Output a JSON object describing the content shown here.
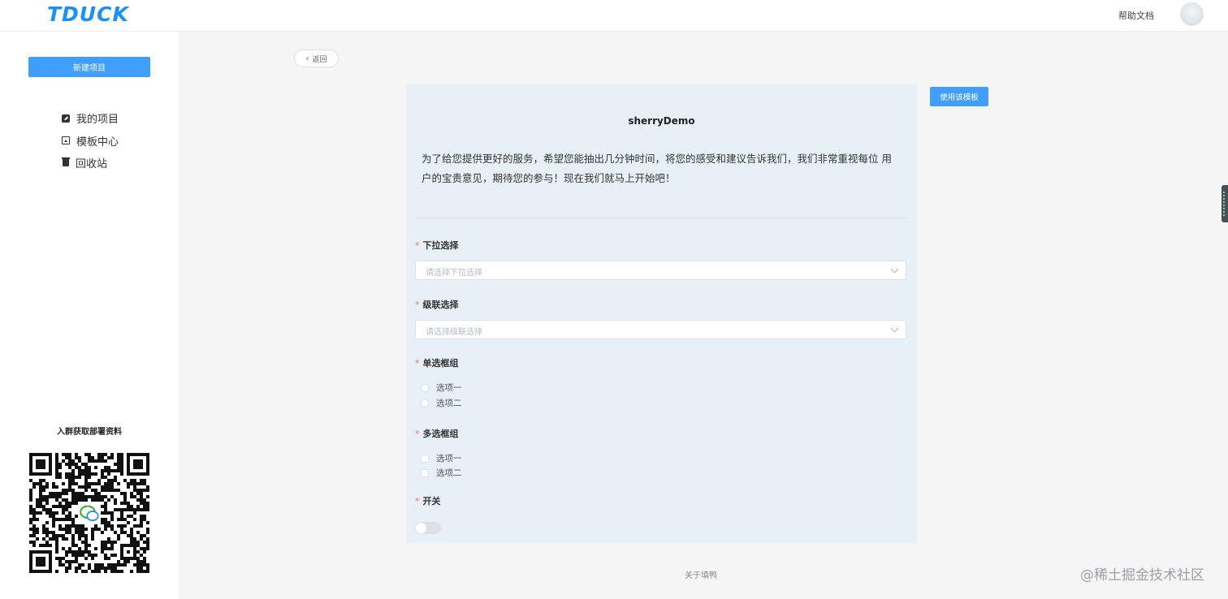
{
  "header": {
    "logo_text": "TDUCK",
    "help_link": "帮助文档",
    "avatar": "user-avatar"
  },
  "sidebar": {
    "new_project_label": "新建项目",
    "items": [
      {
        "label": "我的项目",
        "icon": "edit-icon"
      },
      {
        "label": "模板中心",
        "icon": "template-icon"
      },
      {
        "label": "回收站",
        "icon": "trash-icon"
      }
    ],
    "qr_title": "入群获取部署资料"
  },
  "toolbar": {
    "back_label": "返回",
    "use_template_label": "使用该模板"
  },
  "form": {
    "title": "sherryDemo",
    "description": "为了给您提供更好的服务，希望您能抽出几分钟时间，将您的感受和建议告诉我们，我们非常重视每位 用户的宝贵意见，期待您的参与！现在我们就马上开始吧！",
    "questions": [
      {
        "label": "下拉选择",
        "required_mark": "*",
        "placeholder": "请选择下拉选择"
      },
      {
        "label": "级联选择",
        "required_mark": "*",
        "placeholder": "请选择级联选择"
      },
      {
        "label": "单选框组",
        "required_mark": "*",
        "options": [
          "选项一",
          "选项二"
        ]
      },
      {
        "label": "多选框组",
        "required_mark": "*",
        "options": [
          "选项一",
          "选项二"
        ]
      },
      {
        "label": "开关",
        "required_mark": "*",
        "value": "off"
      }
    ]
  },
  "footer": {
    "about_link": "关于填鸭",
    "watermark": "@稀土掘金技术社区"
  },
  "colors": {
    "accent": "#409eff",
    "logo": "#1890ff",
    "form_background": "#e8f0f7",
    "required": "#f56c6c"
  }
}
